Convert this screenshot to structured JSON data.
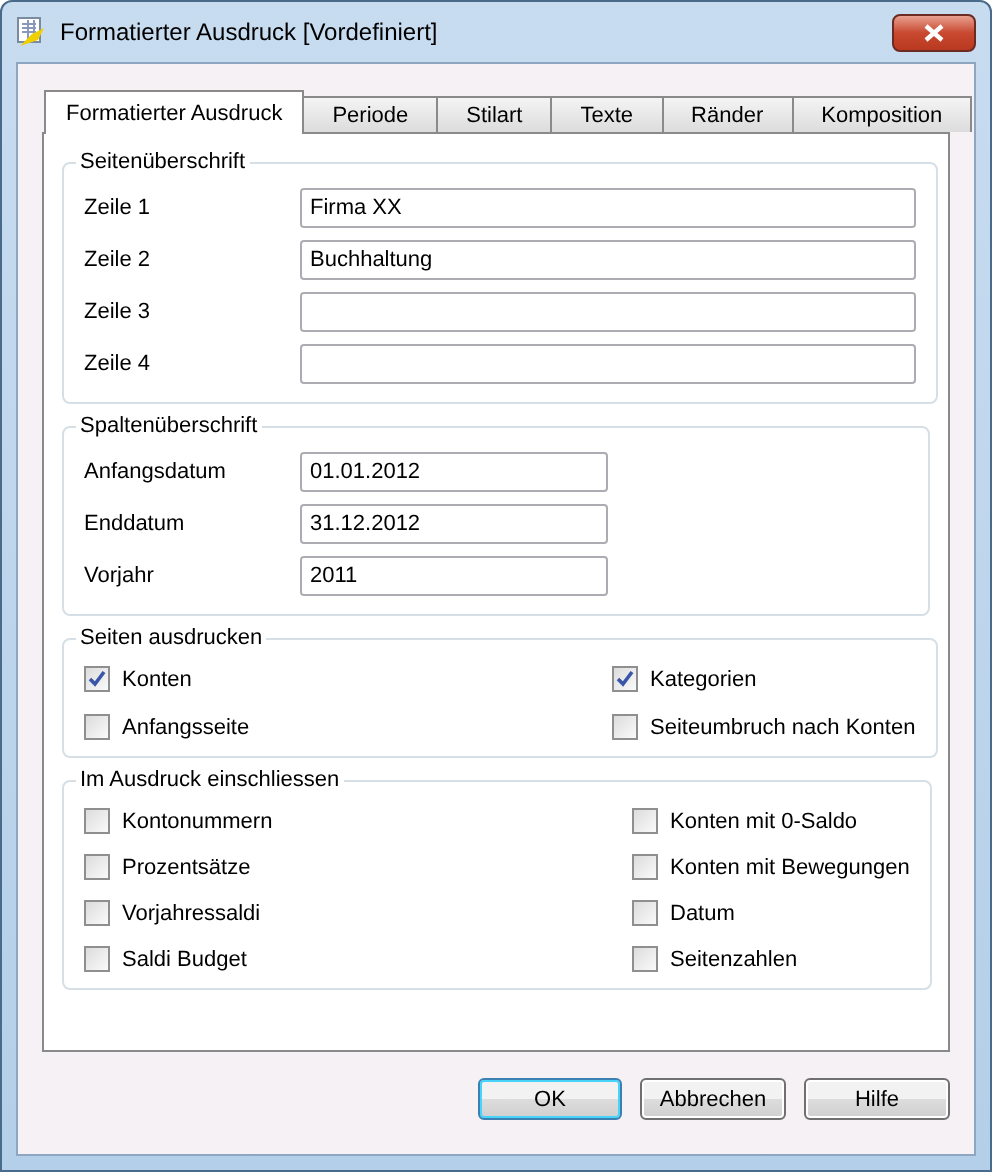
{
  "window": {
    "title": "Formatierter Ausdruck [Vordefiniert]"
  },
  "tabs": [
    {
      "label": "Formatierter Ausdruck",
      "selected": true
    },
    {
      "label": "Periode",
      "selected": false
    },
    {
      "label": "Stilart",
      "selected": false
    },
    {
      "label": "Texte",
      "selected": false
    },
    {
      "label": "Ränder",
      "selected": false
    },
    {
      "label": "Komposition",
      "selected": false
    }
  ],
  "page_header": {
    "title": "Seitenüberschrift",
    "fields": [
      {
        "label": "Zeile 1",
        "value": "Firma XX"
      },
      {
        "label": "Zeile 2",
        "value": "Buchhaltung"
      },
      {
        "label": "Zeile 3"
      },
      {
        "label": "Zeile 4"
      }
    ]
  },
  "column_header": {
    "title": "Spaltenüberschrift",
    "fields": [
      {
        "label": "Anfangsdatum",
        "value": "01.01.2012"
      },
      {
        "label": "Enddatum",
        "value": "31.12.2012"
      },
      {
        "label": "Vorjahr",
        "value": "2011"
      }
    ]
  },
  "print_pages": {
    "title": "Seiten ausdrucken",
    "options": [
      {
        "label": "Konten",
        "checked": true
      },
      {
        "label": "Kategorien",
        "checked": true
      },
      {
        "label": "Anfangsseite",
        "checked": false
      },
      {
        "label": "Seiteumbruch nach Konten",
        "checked": false
      }
    ]
  },
  "include": {
    "title": "Im Ausdruck einschliessen",
    "options": [
      {
        "label": "Kontonummern",
        "checked": false
      },
      {
        "label": "Konten mit 0-Saldo",
        "checked": false
      },
      {
        "label": "Prozentsätze",
        "checked": false
      },
      {
        "label": "Konten mit Bewegungen",
        "checked": false
      },
      {
        "label": "Vorjahressaldi",
        "checked": false
      },
      {
        "label": "Datum",
        "checked": false
      },
      {
        "label": "Saldi Budget",
        "checked": false
      },
      {
        "label": "Seitenzahlen",
        "checked": false
      }
    ]
  },
  "buttons": [
    {
      "label": "OK",
      "default": true
    },
    {
      "label": "Abbrechen",
      "default": false
    },
    {
      "label": "Hilfe",
      "default": false
    }
  ]
}
